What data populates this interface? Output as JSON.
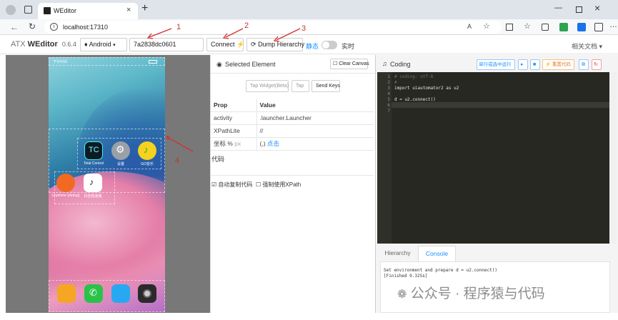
{
  "browser": {
    "tab_title": "WEditor",
    "url": "localhost:17310"
  },
  "app": {
    "brand_prefix": "ATX ",
    "brand": "WEditor",
    "version": "0.6.4",
    "platform": "Android",
    "device_id": "7a2838dc0601",
    "connect_label": "Connect",
    "dump_label": "Dump Hierarchy",
    "static_label": "静态",
    "realtime_label": "实时",
    "docs_label": "相关文档"
  },
  "phone": {
    "status_time": "下午4:59",
    "apps": [
      {
        "label": "Total Control"
      },
      {
        "label": "设置"
      },
      {
        "label": "GO音乐"
      },
      {
        "label": "Linphone (debug)"
      },
      {
        "label": "抖音极速版"
      }
    ]
  },
  "panel": {
    "title": "Selected Element",
    "clear_canvas": "Clear Canvas",
    "tap_widget": "Tap Widget(Beta)",
    "tap": "Tap",
    "send_keys": "Send Keys",
    "prop_header": "Prop",
    "value_header": "Value",
    "rows": [
      {
        "prop": "activity",
        "value": ".launcher.Launcher"
      },
      {
        "prop": "XPathLite",
        "value": "//"
      }
    ],
    "coord_label": "坐标 %",
    "coord_unit": "px",
    "coord_value": "(,)",
    "coord_link": "点击",
    "code_label": "代码",
    "auto_copy": "自动复制代码",
    "force_xpath": "强制使用XPath"
  },
  "coding": {
    "title": "Coding",
    "run_line": "单行或选中运行",
    "reset_code": "重置代码",
    "lines": [
      "# coding: utf-8",
      "#",
      "import uiautomator2 as u2",
      "",
      "d = u2.connect()",
      "",
      ""
    ],
    "tabs": [
      "Hierarchy",
      "Console"
    ],
    "console_lines": [
      "Set environment and prepare d = u2.connect()",
      "[Finished 9.325s]"
    ]
  },
  "watermark": "公众号 · 程序猿与代码",
  "annotations": [
    "1",
    "2",
    "3",
    "4"
  ],
  "colors": {
    "accent": "#1890ff",
    "annot": "#d63030",
    "editor_bg": "#272822"
  }
}
